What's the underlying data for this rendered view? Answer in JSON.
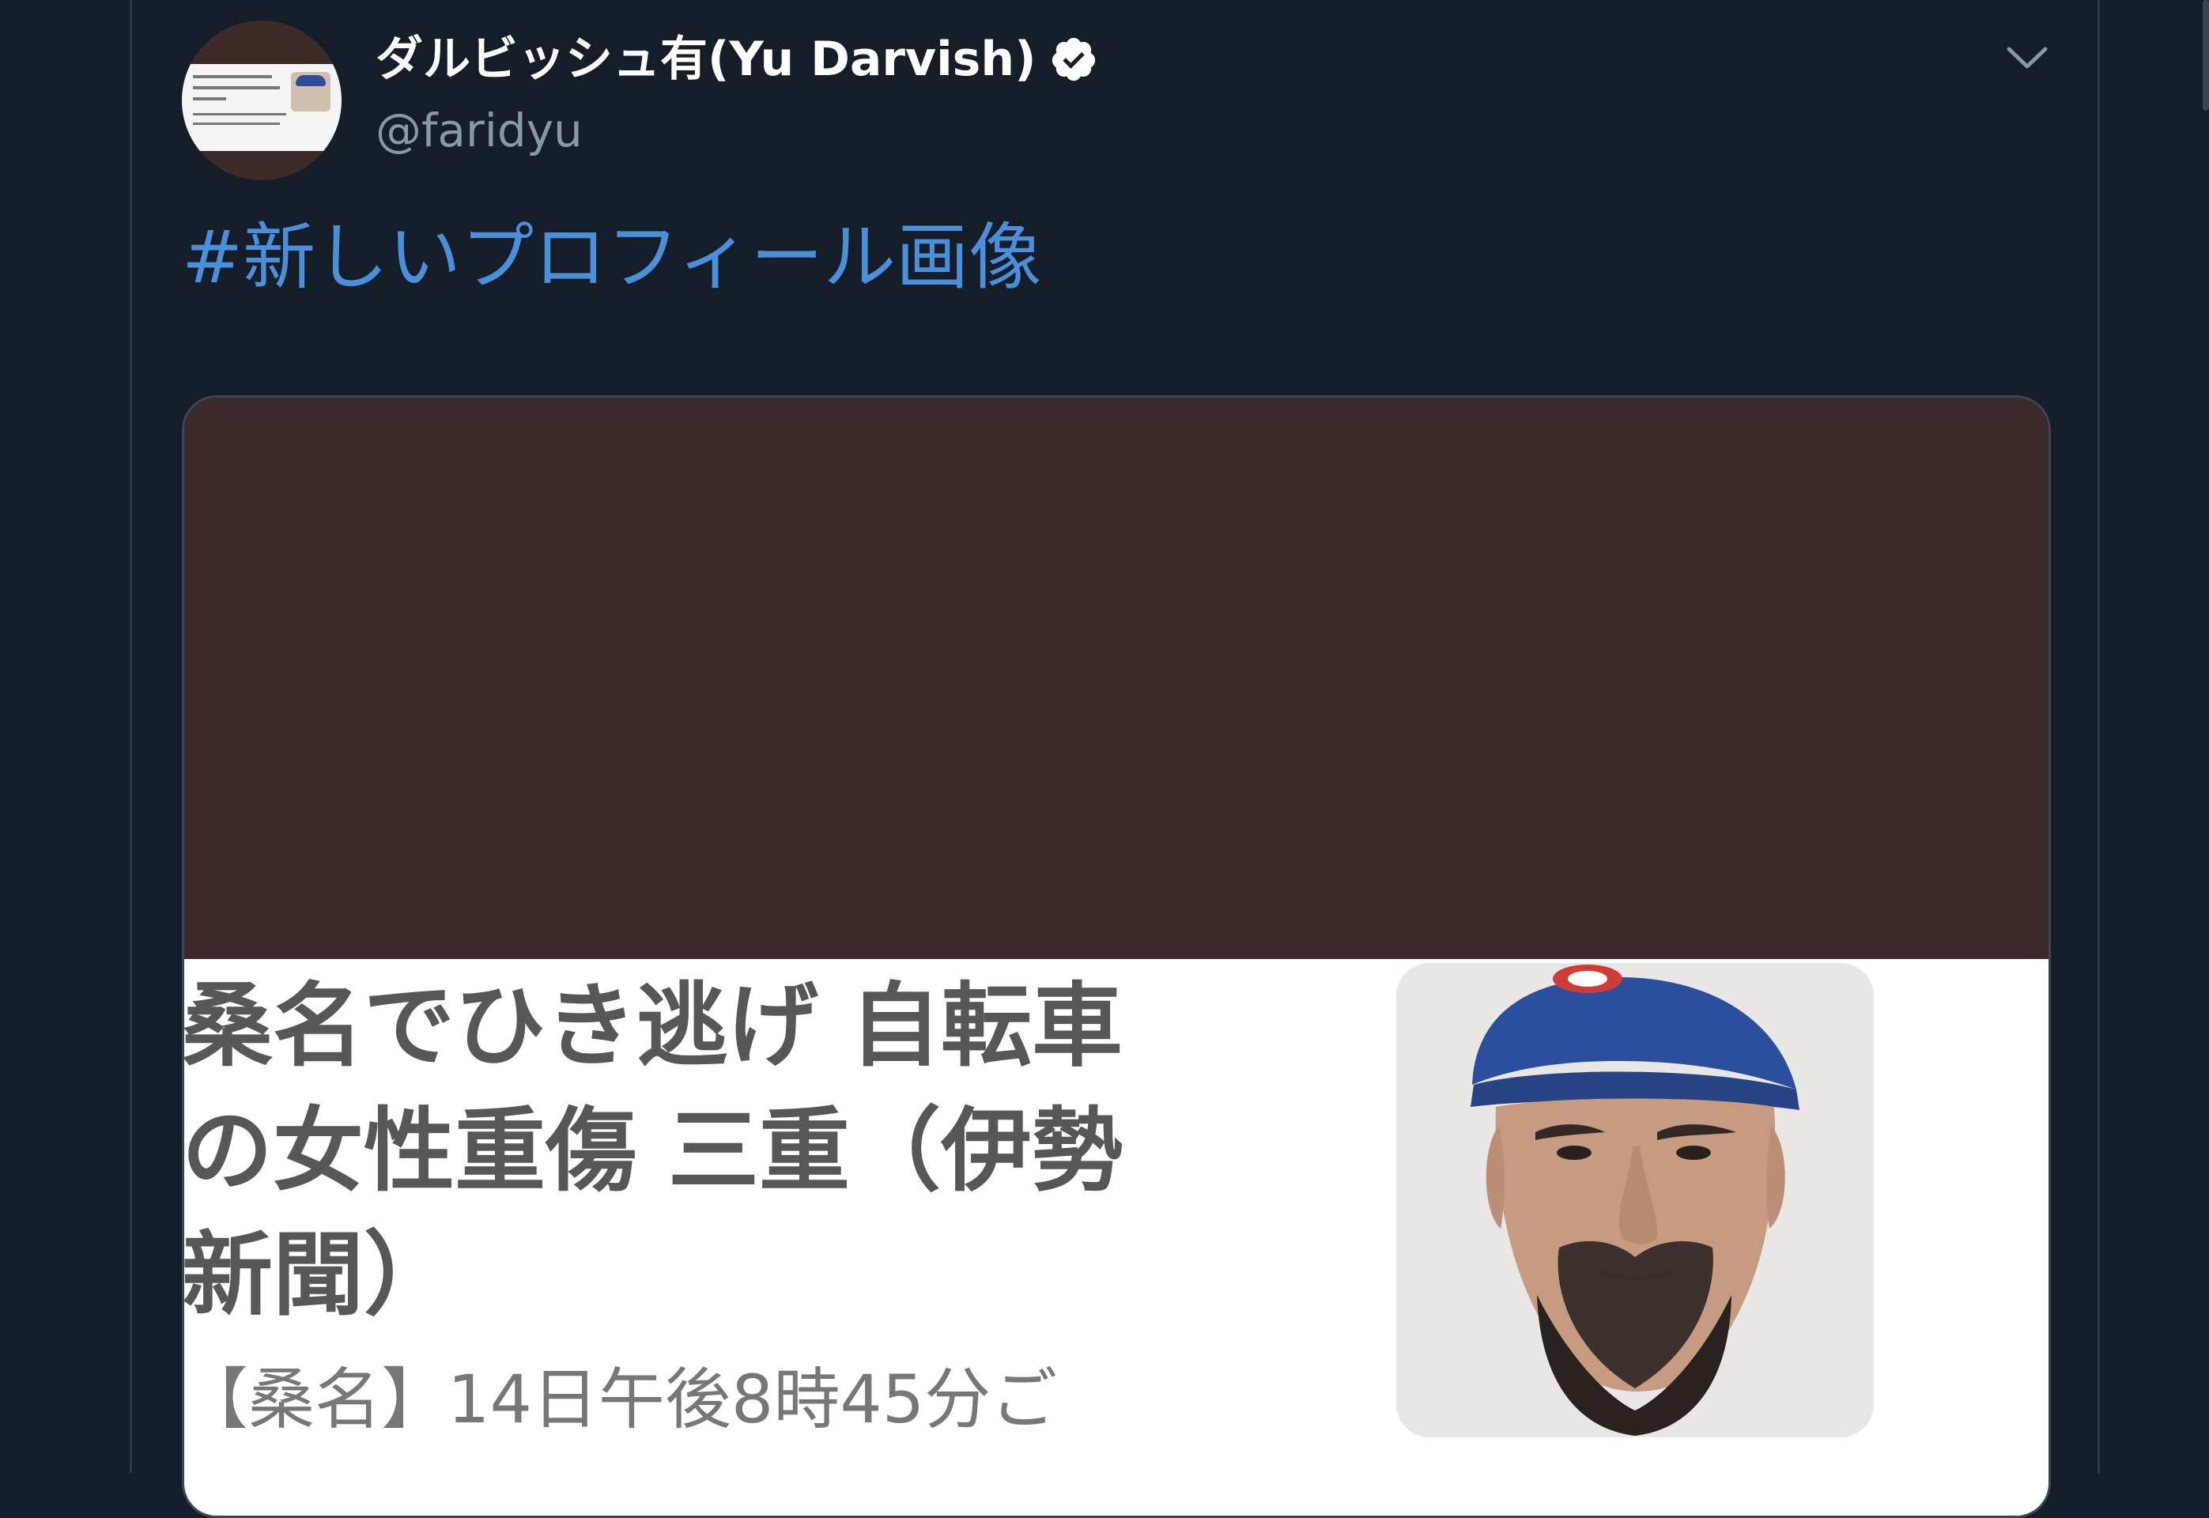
{
  "tweet": {
    "display_name": "ダルビッシュ有(Yu Darvish)",
    "handle": "@faridyu",
    "hashtag": "#新しいプロフィール画像"
  },
  "embedded_article": {
    "title_line_1": "桑名でひき逃げ 自転車",
    "title_line_2": "の女性重傷 三重（伊勢",
    "title_line_3": "新聞）",
    "summary": "【桑名】14日午後8時45分ご"
  },
  "icons": {
    "verified": "verified-badge-icon",
    "menu": "chevron-down-icon"
  },
  "colors": {
    "page_background": "#151d29",
    "name": "#ffffff",
    "handle": "#8899a6",
    "hashtag": "#4a8fdb",
    "media_background": "#3b2a29",
    "article_text": "#575757"
  }
}
